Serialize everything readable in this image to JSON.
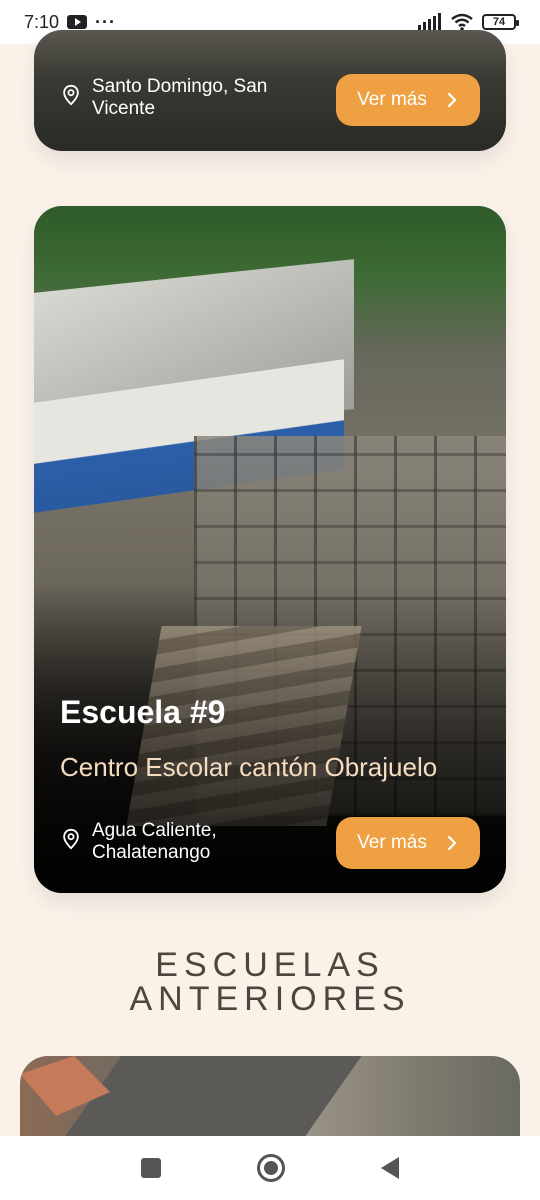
{
  "status_bar": {
    "time": "7:10",
    "overflow": "···",
    "battery": "74",
    "icons": [
      "youtube-icon",
      "signal-icon",
      "wifi-icon",
      "battery-icon"
    ]
  },
  "cards": [
    {
      "location": "Santo Domingo, San Vicente",
      "location_lines": [
        "Santo Domingo, San",
        "Vicente"
      ],
      "button_label": "Ver más"
    },
    {
      "title": "Escuela #9",
      "subtitle": "Centro Escolar cantón Obrajuelo",
      "location_lines": [
        "Agua Caliente,",
        "Chalatenango"
      ],
      "button_label": "Ver más"
    }
  ],
  "section": {
    "line1": "ESCUELAS",
    "line2": "ANTERIORES"
  },
  "colors": {
    "background": "#faf1e9",
    "accent": "#eea042",
    "heading": "#4c463c",
    "subtitle": "#f5dcc0"
  },
  "nav": {
    "icons": [
      "recents-icon",
      "home-icon",
      "back-icon"
    ]
  }
}
